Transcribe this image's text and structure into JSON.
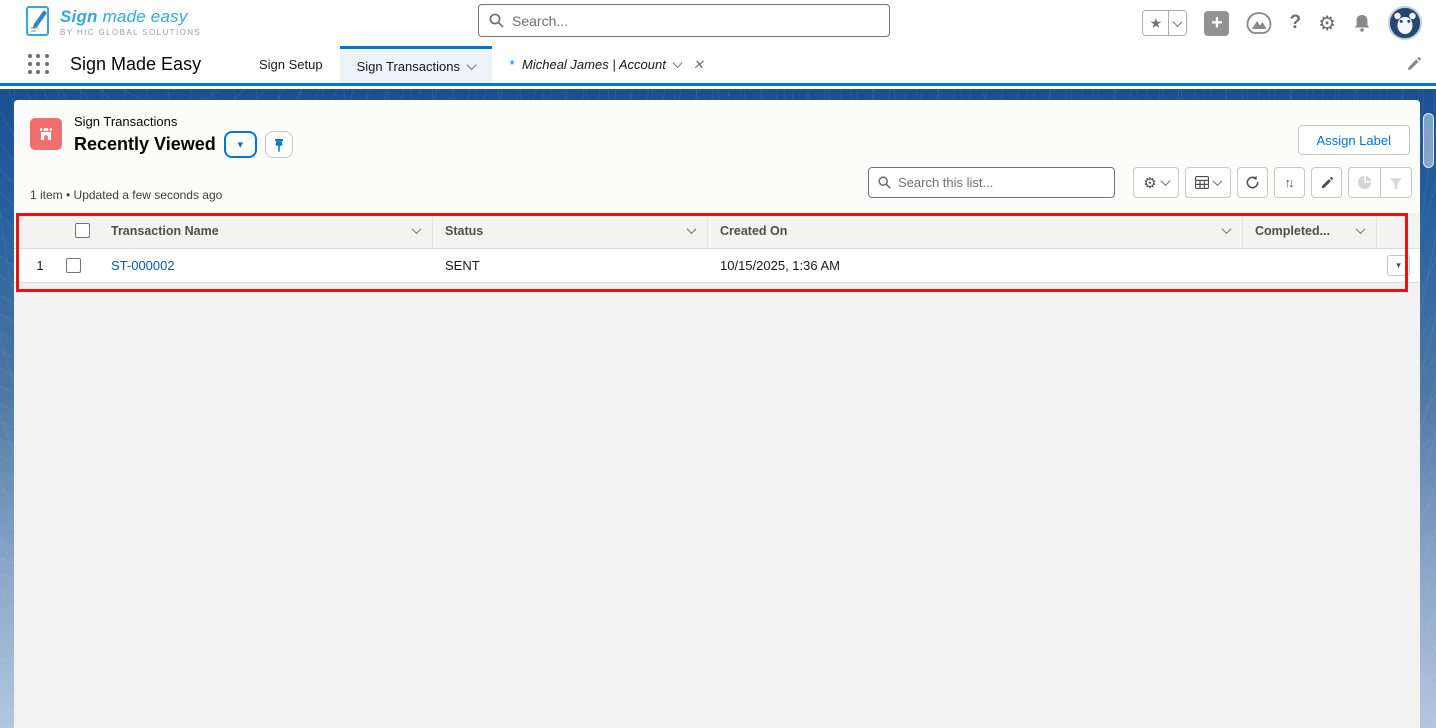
{
  "header": {
    "logo_title_em": "Sign",
    "logo_title_rest": " made easy",
    "logo_subtitle": "BY HIC GLOBAL SOLUTIONS",
    "search_placeholder": "Search..."
  },
  "nav": {
    "app_name": "Sign Made Easy",
    "tab_sign_setup": "Sign Setup",
    "tab_sign_transactions": "Sign Transactions",
    "tab_temp_mark": "*",
    "tab_temp_label": "Micheal James | Account"
  },
  "list": {
    "object_label": "Sign Transactions",
    "view_name": "Recently Viewed",
    "meta": "1 item • Updated a few seconds ago",
    "assign_label": "Assign Label",
    "search_placeholder": "Search this list...",
    "columns": {
      "name": "Transaction Name",
      "status": "Status",
      "created": "Created On",
      "completed": "Completed..."
    },
    "row": {
      "num": "1",
      "name": "ST-000002",
      "status": "SENT",
      "created": "10/15/2025, 1:36 AM"
    }
  },
  "icons": {
    "star": "★",
    "plus": "+",
    "question": "?",
    "gear": "⚙",
    "chevron_filled": "▾",
    "close": "✕",
    "sort": "↑↓"
  },
  "colors": {
    "brand_blue": "#0176d3",
    "logo_blue": "#35a7dc",
    "object_icon": "#f06e6e",
    "annotation_red": "#ee1111",
    "link_blue": "#0b5cab"
  }
}
